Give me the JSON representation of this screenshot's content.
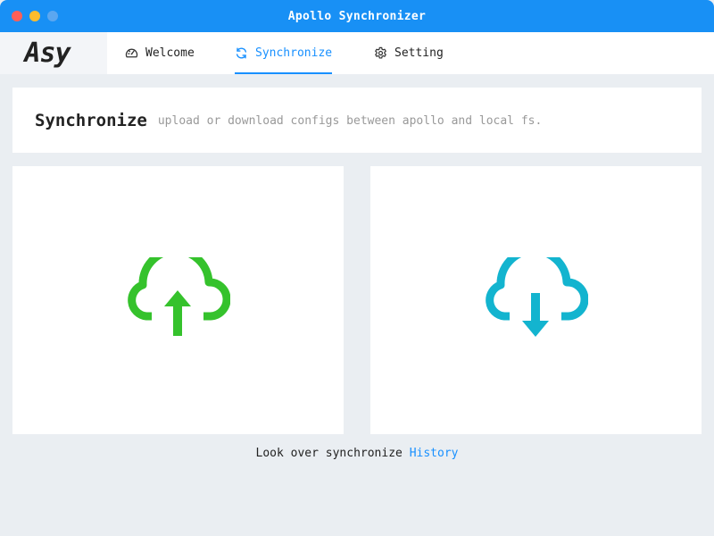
{
  "window": {
    "title": "Apollo Synchronizer"
  },
  "logo": {
    "text": "Asy"
  },
  "nav": {
    "tabs": [
      {
        "label": "Welcome",
        "icon": "dashboard-gauge-icon",
        "active": false
      },
      {
        "label": "Synchronize",
        "icon": "sync-icon",
        "active": true
      },
      {
        "label": "Setting",
        "icon": "gear-icon",
        "active": false
      }
    ]
  },
  "header": {
    "title": "Synchronize",
    "subtitle": "upload or download configs between apollo and local fs."
  },
  "actions": {
    "upload": {
      "icon": "cloud-upload-icon",
      "color": "#35c22c"
    },
    "download": {
      "icon": "cloud-download-icon",
      "color": "#13b4cf"
    }
  },
  "footer": {
    "prefix": "Look over synchronize",
    "link": "History"
  },
  "colors": {
    "accent": "#1890ff",
    "titlebar": "#1890f5",
    "background": "#eaeef2"
  }
}
